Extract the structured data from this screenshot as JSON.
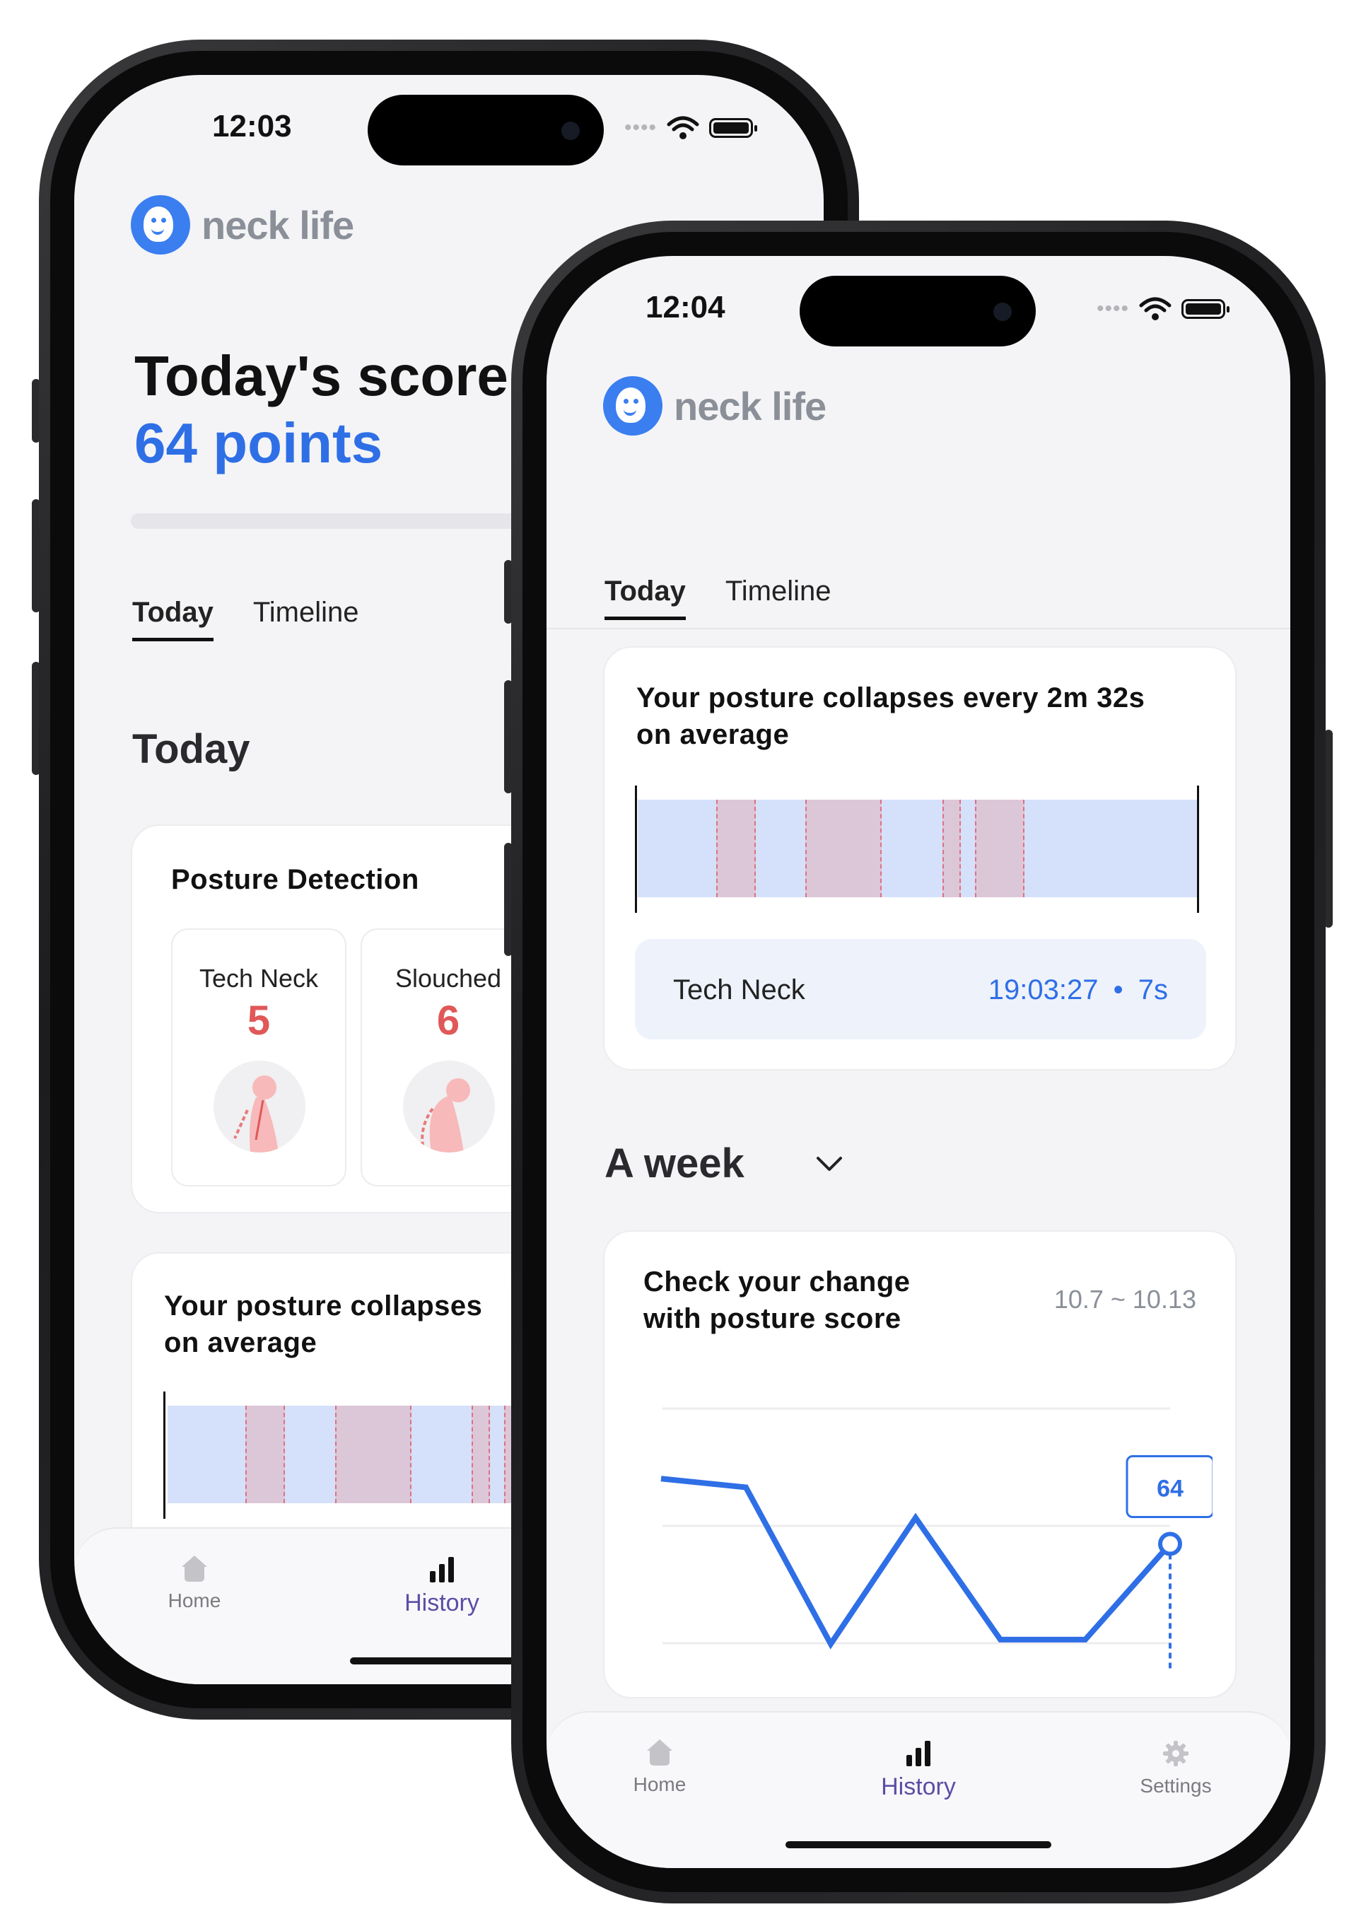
{
  "back_phone": {
    "status": {
      "time": "12:03"
    },
    "app": {
      "name": "neck life"
    },
    "score": {
      "heading": "Today's score",
      "value": "64 points"
    },
    "tabs": [
      {
        "label": "Today"
      },
      {
        "label": "Timeline"
      }
    ],
    "section_title": "Today",
    "posture_detection": {
      "title": "Posture Detection",
      "items": [
        {
          "label": "Tech Neck",
          "count": "5"
        },
        {
          "label": "Slouched",
          "count": "6"
        }
      ]
    },
    "collapse_card": {
      "line1": "Your posture collapses",
      "line2": "on average"
    },
    "nav": [
      {
        "label": "Home"
      },
      {
        "label": "History"
      }
    ]
  },
  "front_phone": {
    "status": {
      "time": "12:04"
    },
    "app": {
      "name": "neck life"
    },
    "tabs": [
      {
        "label": "Today"
      },
      {
        "label": "Timeline"
      }
    ],
    "collapse_card": {
      "line1": "Your posture collapses every 2m 32s",
      "line2": "on average",
      "event": {
        "type": "Tech Neck",
        "time": "19:03:27",
        "sep": "•",
        "duration": "7s"
      }
    },
    "period": {
      "label": "A week"
    },
    "score_card": {
      "line1": "Check your change",
      "line2": "with posture score",
      "date_range": "10.7 ~ 10.13"
    },
    "nav": [
      {
        "label": "Home"
      },
      {
        "label": "History"
      },
      {
        "label": "Settings"
      }
    ]
  },
  "chart_data": {
    "type": "line",
    "x": [
      1,
      2,
      3,
      4,
      5,
      6,
      7
    ],
    "values": [
      79,
      77,
      41,
      70,
      42,
      42,
      64
    ],
    "ylim": [
      35,
      100
    ],
    "grid": true,
    "annotation": "64"
  },
  "colors": {
    "accent_blue": "#2f6fe6",
    "count_red": "#e05858",
    "history_purple": "#5b4ea6",
    "timeline_blue": "#d5e1fb",
    "timeline_event": "#dcc7d8"
  }
}
